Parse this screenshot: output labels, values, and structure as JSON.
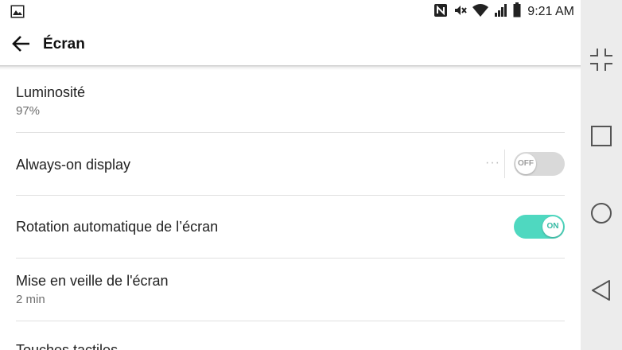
{
  "status_bar": {
    "time": "9:21 AM",
    "icons": [
      "gallery-icon",
      "nfc-icon",
      "mute-icon",
      "wifi-icon",
      "signal-icon",
      "battery-icon"
    ]
  },
  "app_bar": {
    "title": "Écran",
    "back_icon": "arrow-left-icon"
  },
  "settings": {
    "brightness": {
      "title": "Luminosité",
      "value": "97%"
    },
    "always_on": {
      "title": "Always-on display",
      "toggle_label": "OFF",
      "enabled": false
    },
    "auto_rotate": {
      "title": "Rotation automatique de l’écran",
      "toggle_label": "ON",
      "enabled": true
    },
    "screen_timeout": {
      "title": "Mise en veille de l'écran",
      "value": "2 min"
    },
    "touch_keys": {
      "title": "Touches tactiles"
    }
  },
  "nav_bar": {
    "buttons": [
      "collapse-icon",
      "recents-square-icon",
      "home-circle-icon",
      "back-triangle-icon"
    ]
  },
  "colors": {
    "accent_on": "#4fd8c0",
    "toggle_off": "#d9d9d9",
    "nav_background": "#ececec"
  }
}
